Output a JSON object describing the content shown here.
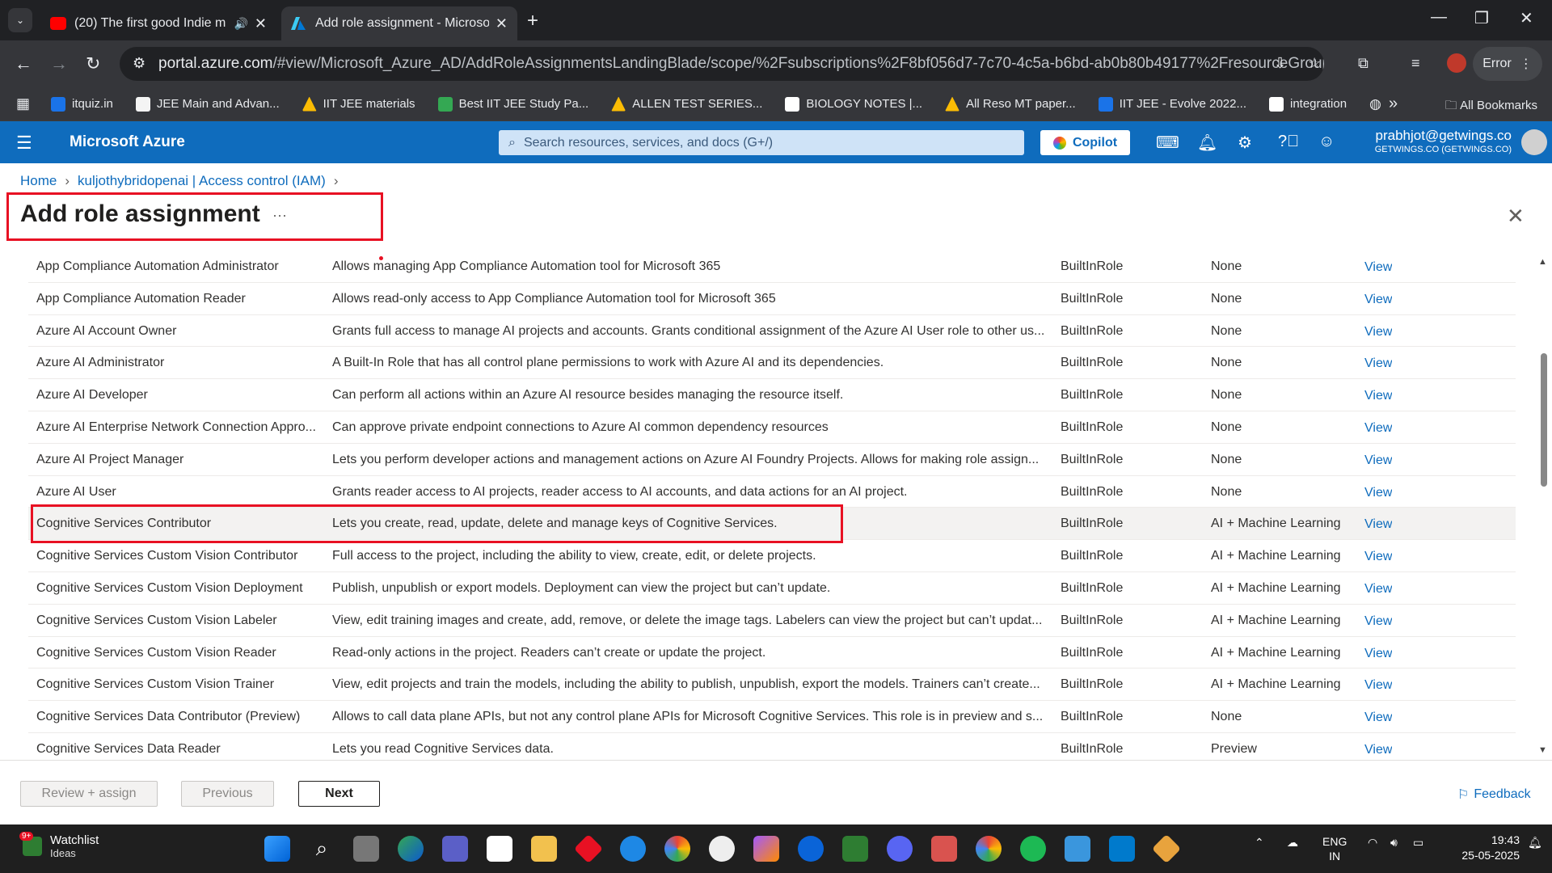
{
  "browser": {
    "tabs": [
      {
        "title": "(20) The first good Indie m",
        "favicon": "youtube-icon",
        "audio": true
      },
      {
        "title": "Add role assignment - Microso",
        "favicon": "azure-icon"
      }
    ],
    "url_host": "portal.azure.com",
    "url_path": "/#view/Microsoft_Azure_AD/AddRoleAssignmentsLandingBlade/scope/%2Fsubscriptions%2F8bf056d7-7c70-4c5a-b6bd-ab0b80b49177%2FresourceGroups%2...",
    "profile_button": "Error",
    "bookmarks": [
      {
        "label": "itquiz.in",
        "color": "#1a73e8"
      },
      {
        "label": "JEE Main and Advan...",
        "color": "#f4f4f4"
      },
      {
        "label": "IIT JEE materials",
        "color": "#fbbc04"
      },
      {
        "label": "Best IIT JEE Study Pa...",
        "color": "#34a853"
      },
      {
        "label": "ALLEN TEST SERIES...",
        "color": "#fbbc04"
      },
      {
        "label": "BIOLOGY NOTES |...",
        "color": "#ffffff"
      },
      {
        "label": "All Reso MT paper...",
        "color": "#fbbc04"
      },
      {
        "label": "IIT JEE - Evolve 2022...",
        "color": "#1a73e8"
      },
      {
        "label": "integration",
        "color": "#ffffff"
      }
    ],
    "all_bookmarks": "All Bookmarks"
  },
  "azure": {
    "brand": "Microsoft Azure",
    "search_placeholder": "Search resources, services, and docs (G+/)",
    "copilot": "Copilot",
    "user_name": "prabhjot@getwings.co",
    "user_org": "GETWINGS.CO (GETWINGS.CO)"
  },
  "breadcrumb": {
    "home": "Home",
    "parent": "kuljothybridopenai | Access control (IAM)"
  },
  "page": {
    "title": "Add role assignment",
    "more": "···"
  },
  "roles": [
    {
      "name": "App Compliance Automation Administrator",
      "desc": "Allows managing App Compliance Automation tool for Microsoft 365",
      "type": "BuiltInRole",
      "category": "None",
      "view": "View"
    },
    {
      "name": "App Compliance Automation Reader",
      "desc": "Allows read-only access to App Compliance Automation tool for Microsoft 365",
      "type": "BuiltInRole",
      "category": "None",
      "view": "View"
    },
    {
      "name": "Azure AI Account Owner",
      "desc": "Grants full access to manage AI projects and accounts. Grants conditional assignment of the Azure AI User role to other us...",
      "type": "BuiltInRole",
      "category": "None",
      "view": "View"
    },
    {
      "name": "Azure AI Administrator",
      "desc": "A Built-In Role that has all control plane permissions to work with Azure AI and its dependencies.",
      "type": "BuiltInRole",
      "category": "None",
      "view": "View"
    },
    {
      "name": "Azure AI Developer",
      "desc": "Can perform all actions within an Azure AI resource besides managing the resource itself.",
      "type": "BuiltInRole",
      "category": "None",
      "view": "View"
    },
    {
      "name": "Azure AI Enterprise Network Connection Appro...",
      "desc": "Can approve private endpoint connections to Azure AI common dependency resources",
      "type": "BuiltInRole",
      "category": "None",
      "view": "View"
    },
    {
      "name": "Azure AI Project Manager",
      "desc": "Lets you perform developer actions and management actions on Azure AI Foundry Projects. Allows for making role assign...",
      "type": "BuiltInRole",
      "category": "None",
      "view": "View"
    },
    {
      "name": "Azure AI User",
      "desc": "Grants reader access to AI projects, reader access to AI accounts, and data actions for an AI project.",
      "type": "BuiltInRole",
      "category": "None",
      "view": "View"
    },
    {
      "name": "Cognitive Services Contributor",
      "desc": "Lets you create, read, update, delete and manage keys of Cognitive Services.",
      "type": "BuiltInRole",
      "category": "AI + Machine Learning",
      "view": "View",
      "selected": true
    },
    {
      "name": "Cognitive Services Custom Vision Contributor",
      "desc": "Full access to the project, including the ability to view, create, edit, or delete projects.",
      "type": "BuiltInRole",
      "category": "AI + Machine Learning",
      "view": "View"
    },
    {
      "name": "Cognitive Services Custom Vision Deployment",
      "desc": "Publish, unpublish or export models. Deployment can view the project but can’t update.",
      "type": "BuiltInRole",
      "category": "AI + Machine Learning",
      "view": "View"
    },
    {
      "name": "Cognitive Services Custom Vision Labeler",
      "desc": "View, edit training images and create, add, remove, or delete the image tags. Labelers can view the project but can’t updat...",
      "type": "BuiltInRole",
      "category": "AI + Machine Learning",
      "view": "View"
    },
    {
      "name": "Cognitive Services Custom Vision Reader",
      "desc": "Read-only actions in the project. Readers can’t create or update the project.",
      "type": "BuiltInRole",
      "category": "AI + Machine Learning",
      "view": "View"
    },
    {
      "name": "Cognitive Services Custom Vision Trainer",
      "desc": "View, edit projects and train the models, including the ability to publish, unpublish, export the models. Trainers can’t create...",
      "type": "BuiltInRole",
      "category": "AI + Machine Learning",
      "view": "View"
    },
    {
      "name": "Cognitive Services Data Contributor (Preview)",
      "desc": "Allows to call data plane APIs, but not any control plane APIs for Microsoft Cognitive Services. This role is in preview and s...",
      "type": "BuiltInRole",
      "category": "None",
      "view": "View"
    },
    {
      "name": "Cognitive Services Data Reader",
      "desc": "Lets you read Cognitive Services data.",
      "type": "BuiltInRole",
      "category": "Preview",
      "view": "View"
    }
  ],
  "footer": {
    "review": "Review + assign",
    "previous": "Previous",
    "next": "Next",
    "feedback": "Feedback"
  },
  "taskbar": {
    "watch_title": "Watchlist",
    "watch_sub": "Ideas",
    "watch_badge": "9+",
    "lang": "ENG",
    "region": "IN",
    "time": "19:43",
    "date": "25-05-2025"
  }
}
